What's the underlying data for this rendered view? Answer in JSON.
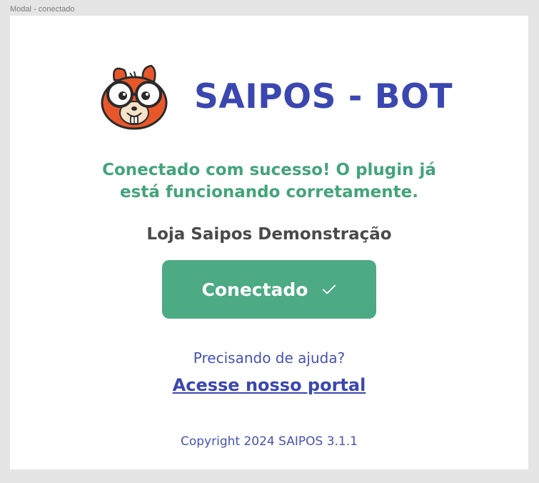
{
  "frame": {
    "label": "Modal - conectado"
  },
  "header": {
    "brand": "SAIPOS - BOT",
    "mascot": "squirrel-mascot-icon"
  },
  "status": {
    "message": "Conectado com sucesso! O plugin já está funcionando corretamente.",
    "store_name": "Loja Saipos Demonstração"
  },
  "connect_button": {
    "label": "Conectado",
    "icon": "check-icon"
  },
  "help": {
    "question": "Precisando de ajuda?",
    "link_label": "Acesse nosso portal"
  },
  "footer": {
    "copyright": "Copyright 2024 SAIPOS 3.1.1"
  },
  "colors": {
    "brand": "#3b47b0",
    "success": "#43a47a",
    "button": "#4caa84",
    "mascot": "#e8572a"
  }
}
